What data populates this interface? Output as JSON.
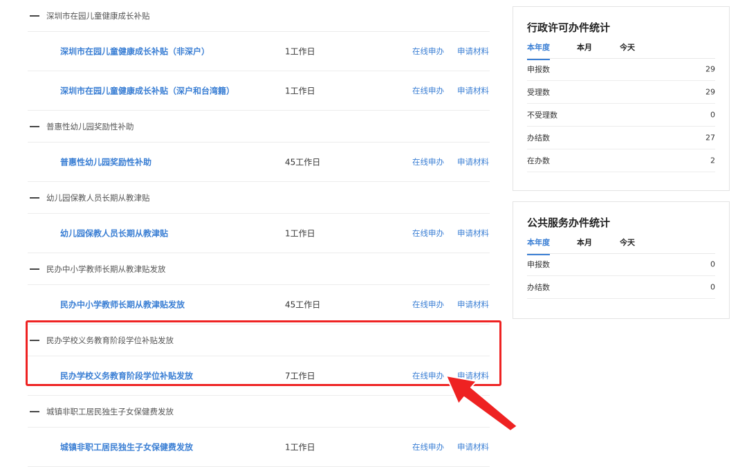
{
  "list": {
    "groups": [
      {
        "title": "深圳市在园儿童健康成长补贴",
        "items": [
          {
            "name": "深圳市在园儿童健康成长补贴（非深户）",
            "days": "1工作日",
            "online": "在线申办",
            "material": "申请材料"
          },
          {
            "name": "深圳市在园儿童健康成长补贴（深户和台湾籍）",
            "days": "1工作日",
            "online": "在线申办",
            "material": "申请材料"
          }
        ]
      },
      {
        "title": "普惠性幼儿园奖励性补助",
        "items": [
          {
            "name": "普惠性幼儿园奖励性补助",
            "days": "45工作日",
            "online": "在线申办",
            "material": "申请材料"
          }
        ]
      },
      {
        "title": "幼儿园保教人员长期从教津贴",
        "items": [
          {
            "name": "幼儿园保教人员长期从教津贴",
            "days": "1工作日",
            "online": "在线申办",
            "material": "申请材料"
          }
        ]
      },
      {
        "title": "民办中小学教师长期从教津贴发放",
        "items": [
          {
            "name": "民办中小学教师长期从教津贴发放",
            "days": "45工作日",
            "online": "在线申办",
            "material": "申请材料"
          }
        ]
      },
      {
        "title": "民办学校义务教育阶段学位补贴发放",
        "items": [
          {
            "name": "民办学校义务教育阶段学位补贴发放",
            "days": "7工作日",
            "online": "在线申办",
            "material": "申请材料"
          }
        ]
      },
      {
        "title": "城镇非职工居民独生子女保健费发放",
        "items": [
          {
            "name": "城镇非职工居民独生子女保健费发放",
            "days": "1工作日",
            "online": "在线申办",
            "material": "申请材料"
          }
        ]
      }
    ]
  },
  "admin_stats": {
    "title": "行政许可办件统计",
    "tabs": [
      "本年度",
      "本月",
      "今天"
    ],
    "rows": [
      {
        "label": "申报数",
        "value": "29"
      },
      {
        "label": "受理数",
        "value": "29"
      },
      {
        "label": "不受理数",
        "value": "0"
      },
      {
        "label": "办结数",
        "value": "27"
      },
      {
        "label": "在办数",
        "value": "2"
      }
    ]
  },
  "public_stats": {
    "title": "公共服务办件统计",
    "tabs": [
      "本年度",
      "本月",
      "今天"
    ],
    "rows": [
      {
        "label": "申报数",
        "value": "0"
      },
      {
        "label": "办结数",
        "value": "0"
      }
    ]
  },
  "colors": {
    "link": "#3b7fd4",
    "highlight": "#ee2222"
  }
}
